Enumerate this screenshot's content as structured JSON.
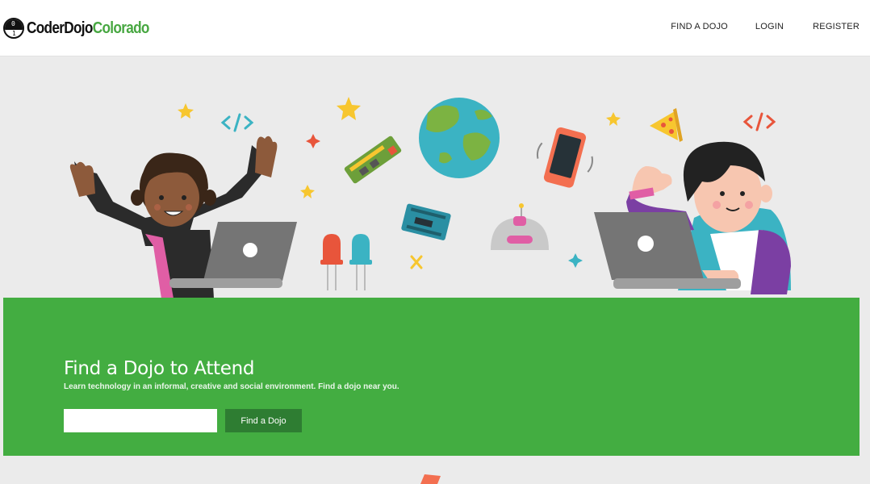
{
  "brand": {
    "name_part1": "CoderDojo",
    "name_part2": "Colorado",
    "mark_top_digit": "0",
    "mark_bottom_digit": "1",
    "colors": {
      "dark": "#111111",
      "green": "#47a741"
    }
  },
  "nav": {
    "items": [
      "FIND A DOJO",
      "LOGIN",
      "REGISTER"
    ]
  },
  "hero_illustration": {
    "icons": [
      "kid-girl",
      "kid-boy",
      "laptop-icon",
      "laptop-icon",
      "globe-icon",
      "phone-icon",
      "star-icon",
      "code-brackets-icon",
      "circuit-board-icon",
      "arduino-icon",
      "led-icon",
      "robot-icon",
      "pizza-icon",
      "sparkle-icon"
    ]
  },
  "find_panel": {
    "title": "Find a Dojo to Attend",
    "subtitle": "Learn technology in an informal, creative and social environment. Find a dojo near you.",
    "search_value": "",
    "search_placeholder": "",
    "button_label": "Find a Dojo",
    "colors": {
      "panel": "#43ad41",
      "button": "#2e7d32"
    }
  }
}
